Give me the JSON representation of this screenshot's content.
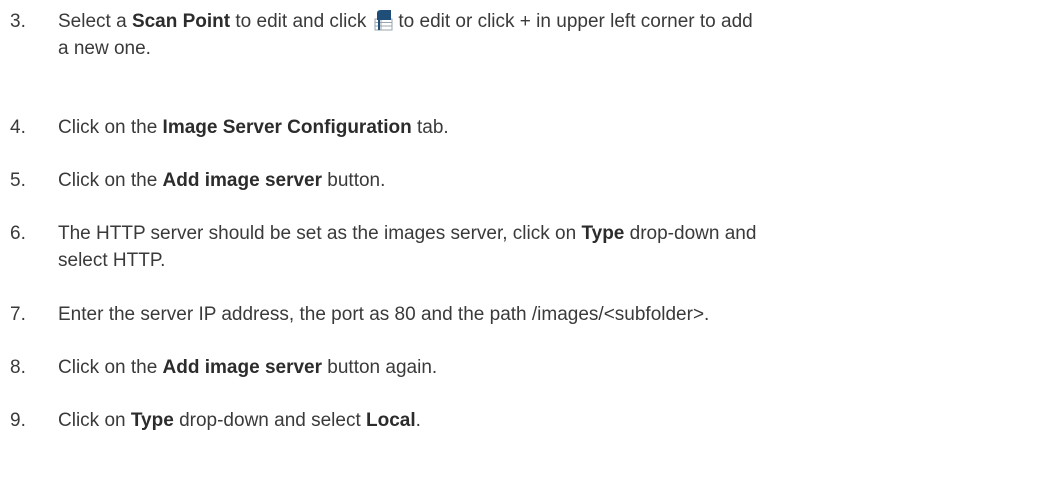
{
  "steps": [
    {
      "number": "3.",
      "line1_a": "Select a ",
      "line1_b": "Scan Point",
      "line1_c": " to edit and click",
      "line1_d": "to edit or click + in upper left corner to add",
      "line2": "a new one.",
      "icon": "edit-table-icon"
    },
    {
      "number": "4.",
      "a": "Click on the ",
      "b": "Image Server Configuration",
      "c": " tab."
    },
    {
      "number": "5.",
      "a": "Click on the ",
      "b": "Add image server",
      "c": " button."
    },
    {
      "number": "6.",
      "line1_a": "The HTTP server should be set as the images server, click on ",
      "line1_b": "Type",
      "line1_c": " drop-down and",
      "line2": "select HTTP."
    },
    {
      "number": "7.",
      "a": "Enter the server IP address, the port as 80 and the path /images/<subfolder>."
    },
    {
      "number": "8.",
      "a": "Click on the ",
      "b": "Add image server",
      "c": " button again."
    },
    {
      "number": "9.",
      "a": "Click on ",
      "b": "Type",
      "c": " drop-down and select ",
      "d": "Local",
      "e": "."
    }
  ],
  "colors": {
    "text": "#3a3a3a",
    "icon_blue": "#1f4e79",
    "icon_grid": "#9aa4ae"
  }
}
